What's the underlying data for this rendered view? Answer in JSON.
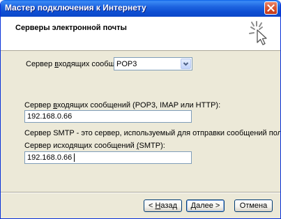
{
  "window": {
    "title": "Мастер подключения к Интернету"
  },
  "header": {
    "title": "Серверы электронной почты"
  },
  "incoming_type": {
    "label_pre": "Сервер ",
    "label_ul": "в",
    "label_post": "ходящих сообщений:",
    "selected": "POP3"
  },
  "incoming_server": {
    "label_pre": "Сервер ",
    "label_ul": "в",
    "label_post": "ходящих сообщений (POP3, IMAP или HTTP):",
    "value": "192.168.0.66"
  },
  "smtp_note": "Сервер SMTP - это сервер, используемый для отправки сообщений  пользователя.",
  "outgoing_server": {
    "label_pre": "Сервер исходящих сообщений ",
    "label_ul": "(",
    "label_post": "SMTP):",
    "value": "192.168.0.66"
  },
  "buttons": {
    "back": {
      "prefix": "< ",
      "ul": "Н",
      "rest": "азад"
    },
    "next": {
      "ul": "Д",
      "rest": "алее >"
    },
    "cancel": "Отмена"
  }
}
